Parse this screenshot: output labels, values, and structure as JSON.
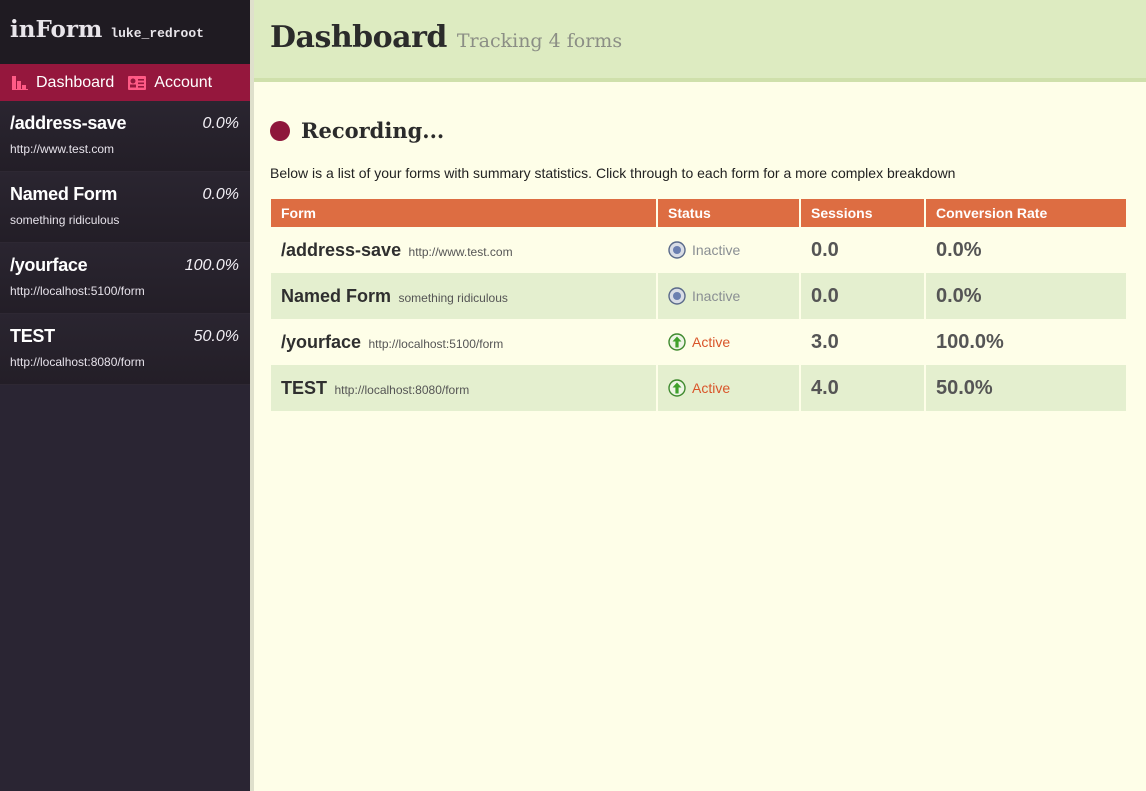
{
  "app": {
    "name": "inForm",
    "user": "luke_redroot"
  },
  "nav": {
    "dashboard_label": "Dashboard",
    "account_label": "Account"
  },
  "sidebar": {
    "forms": [
      {
        "name": "/address-save",
        "url": "http://www.test.com",
        "rate": "0.0%"
      },
      {
        "name": "Named Form",
        "url": "something ridiculous",
        "rate": "0.0%"
      },
      {
        "name": "/yourface",
        "url": "http://localhost:5100/form",
        "rate": "100.0%"
      },
      {
        "name": "TEST",
        "url": "http://localhost:8080/form",
        "rate": "50.0%"
      }
    ]
  },
  "header": {
    "title": "Dashboard",
    "subtitle": "Tracking 4 forms"
  },
  "main": {
    "recording_label": "Recording...",
    "intro": "Below is a list of your forms with summary statistics. Click through to each form for a more complex breakdown",
    "table": {
      "headers": [
        "Form",
        "Status",
        "Sessions",
        "Conversion Rate"
      ],
      "rows": [
        {
          "name": "/address-save",
          "url": "http://www.test.com",
          "status": "Inactive",
          "sessions": "0.0",
          "conversion": "0.0%"
        },
        {
          "name": "Named Form",
          "url": "something ridiculous",
          "status": "Inactive",
          "sessions": "0.0",
          "conversion": "0.0%"
        },
        {
          "name": "/yourface",
          "url": "http://localhost:5100/form",
          "status": "Active",
          "sessions": "3.0",
          "conversion": "100.0%"
        },
        {
          "name": "TEST",
          "url": "http://localhost:8080/form",
          "status": "Active",
          "sessions": "4.0",
          "conversion": "50.0%"
        }
      ]
    }
  },
  "colors": {
    "sidebar_bg": "#2a2533",
    "nav_bg": "#95173d",
    "header_bg": "#ddebc1",
    "table_header_bg": "#dd6d42",
    "active": "#d9552a",
    "inactive": "#8a8f93"
  },
  "icons": {
    "dashboard": "bar-chart-icon",
    "account": "id-card-icon",
    "inactive": "inactive-circle-icon",
    "active": "up-arrow-circle-icon"
  }
}
